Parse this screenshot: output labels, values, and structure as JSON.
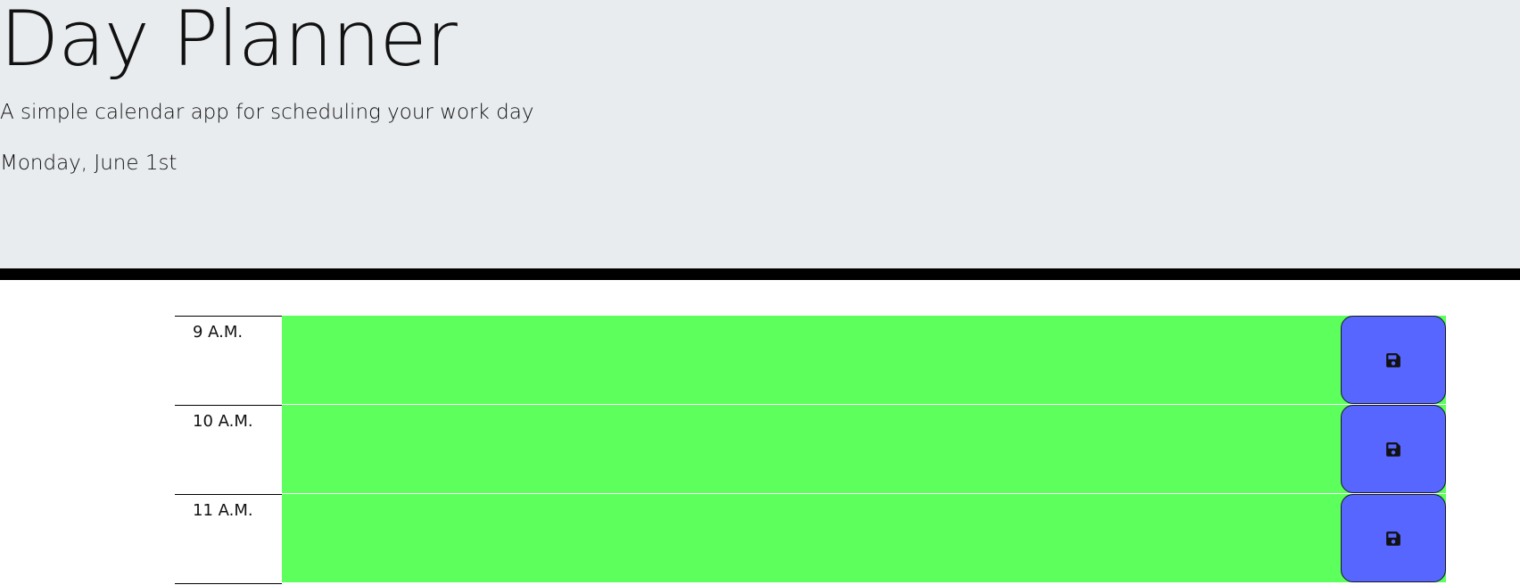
{
  "header": {
    "title": "Day Planner",
    "subtitle": "A simple calendar app for scheduling your work day",
    "current_day": "Monday, June 1st"
  },
  "time_blocks": [
    {
      "hour": "9 A.M.",
      "description": "",
      "status": "future",
      "save_icon": "save-icon"
    },
    {
      "hour": "10 A.M.",
      "description": "",
      "status": "future",
      "save_icon": "save-icon"
    },
    {
      "hour": "11 A.M.",
      "description": "",
      "status": "future",
      "save_icon": "save-icon"
    }
  ],
  "colors": {
    "header_background": "#e9ecef",
    "future_block": "#5cff5c",
    "save_button": "#5766ff",
    "header_rule": "#000000"
  }
}
